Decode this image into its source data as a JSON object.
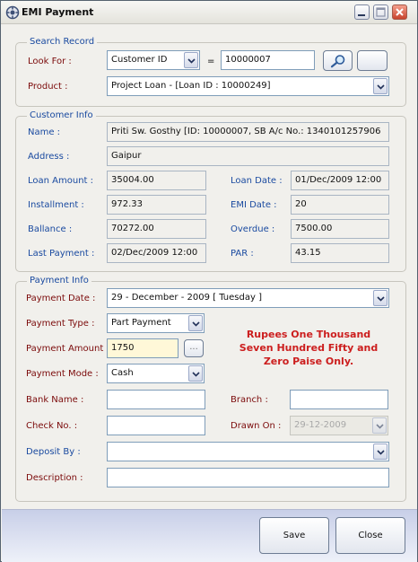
{
  "window": {
    "title": "EMI Payment"
  },
  "search": {
    "group_title": "Search Record",
    "look_for_label": "Look For :",
    "look_for_value": "Customer ID",
    "equals": "=",
    "search_value": "10000007",
    "product_label": "Product :",
    "product_value": "Project Loan - [Loan ID : 10000249]"
  },
  "customer": {
    "group_title": "Customer Info",
    "name_label": "Name :",
    "name_value": "Priti Sw. Gosthy [ID: 10000007, SB A/c No.: 1340101257906",
    "address_label": "Address :",
    "address_value": "Gaipur",
    "loan_amount_label": "Loan Amount :",
    "loan_amount_value": "35004.00",
    "loan_date_label": "Loan Date :",
    "loan_date_value": "01/Dec/2009 12:00",
    "installment_label": "Installment :",
    "installment_value": "972.33",
    "emi_date_label": "EMI Date :",
    "emi_date_value": "20",
    "balance_label": "Ballance :",
    "balance_value": "70272.00",
    "overdue_label": "Overdue :",
    "overdue_value": "7500.00",
    "last_payment_label": "Last Payment :",
    "last_payment_value": "02/Dec/2009 12:00",
    "par_label": "PAR :",
    "par_value": "43.15"
  },
  "payment": {
    "group_title": "Payment Info",
    "date_label": "Payment Date :",
    "date_value": "29 - December - 2009 [ Tuesday ]",
    "type_label": "Payment Type :",
    "type_value": "Part Payment",
    "amount_label": "Payment Amount :",
    "amount_value": "1750",
    "amount_button": "...",
    "mode_label": "Payment Mode :",
    "mode_value": "Cash",
    "amount_words": "Rupees  One Thousand\nSeven Hundred Fifty    and\nZero Paise Only.",
    "bank_label": "Bank Name :",
    "bank_value": "",
    "branch_label": "Branch :",
    "branch_value": "",
    "check_label": "Check No. :",
    "check_value": "",
    "drawn_label": "Drawn On :",
    "drawn_value": "29-12-2009",
    "deposit_label": "Deposit By :",
    "deposit_value": "",
    "description_label": "Description :",
    "description_value": ""
  },
  "footer": {
    "save_label": "Save",
    "close_label": "Close"
  },
  "colors": {
    "label_red": "#7b0a0a",
    "label_blue": "#1a4aa0",
    "amount_words": "#cc1e1e"
  }
}
